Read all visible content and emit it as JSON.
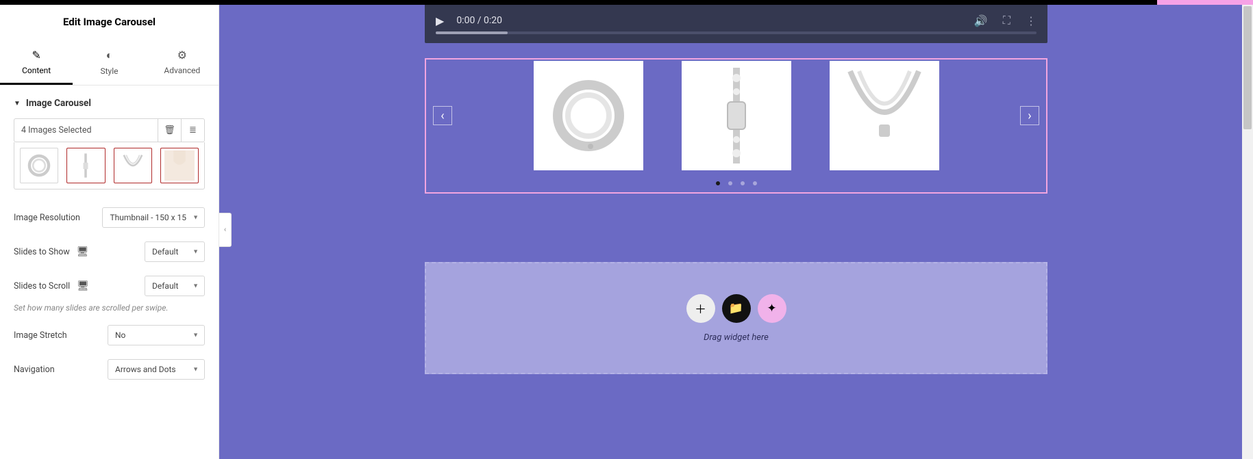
{
  "panel": {
    "title": "Edit Image Carousel",
    "tabs": {
      "content": "Content",
      "style": "Style",
      "advanced": "Advanced"
    },
    "section_title": "Image Carousel",
    "images_selected": "4 Images Selected",
    "fields": {
      "image_resolution_label": "Image Resolution",
      "image_resolution_value": "Thumbnail - 150 x 15",
      "slides_to_show_label": "Slides to Show",
      "slides_to_show_value": "Default",
      "slides_to_scroll_label": "Slides to Scroll",
      "slides_to_scroll_value": "Default",
      "slides_to_scroll_help": "Set how many slides are scrolled per swipe.",
      "image_stretch_label": "Image Stretch",
      "image_stretch_value": "No",
      "navigation_label": "Navigation",
      "navigation_value": "Arrows and Dots"
    }
  },
  "canvas": {
    "video_time": "0:00 / 0:20",
    "drop_text": "Drag widget here"
  }
}
